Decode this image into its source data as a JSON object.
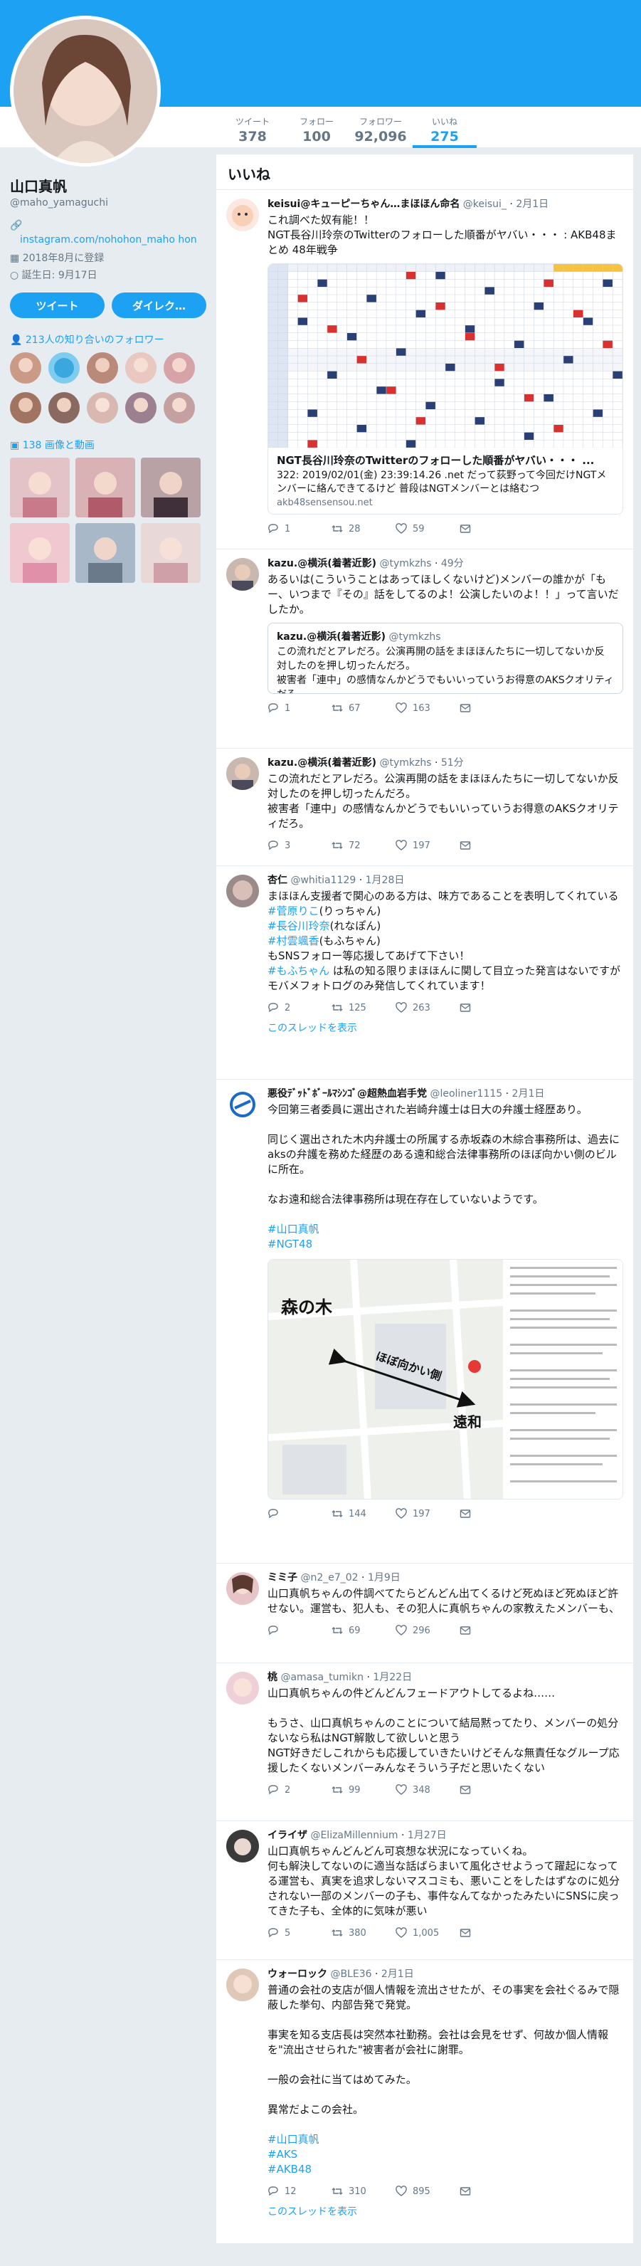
{
  "profile": {
    "name": "山口真帆",
    "handle": "@maho_yamaguchi",
    "link": "instagram.com/nohohon_maho hon",
    "joined": "2018年8月に登録",
    "birthday": "誕生日: 9月17日",
    "tweet_button": "ツイート",
    "dm_button": "ダイレク…",
    "followers_you_know": "213人の知り合いのフォロワー",
    "media_label": "138 画像と動画"
  },
  "stats": [
    {
      "label": "ツイート",
      "value": "378"
    },
    {
      "label": "フォロー",
      "value": "100"
    },
    {
      "label": "フォロワー",
      "value": "92,096"
    },
    {
      "label": "いいね",
      "value": "275"
    }
  ],
  "timeline": {
    "title": "いいね"
  },
  "tweets": [
    {
      "name": "keisui@キューピーちゃん…まほほん命名",
      "handle": "@keisui_",
      "date": "2月1日",
      "text": "これ調べた奴有能！！\nNGT長谷川玲奈のTwitterのフォローした順番がヤバい・・・ : AKB48まとめ 48年戦争",
      "card": {
        "title": "NGT長谷川玲奈のTwitterのフォローした順番がヤバい・・・ ...",
        "desc": "322: 2019/02/01(金) 23:39:14.26 .net だって荻野って今回だけNGTメンバーに絡んできてるけど 普段はNGTメンバーとは絡むつ",
        "url": "akb48sensensou.net"
      },
      "replies": "1",
      "retweets": "28",
      "likes": "59"
    },
    {
      "name": "kazu.@横浜(着著近影)",
      "handle": "@tymkzhs",
      "date": "49分",
      "text": "あるいは(こういうことはあってほしくないけど)メンバーの誰かが「もー、いつまで『その』話をしてるのよ！公演したいのよ！！」って言いだしたか。",
      "quote": {
        "name": "kazu.@横浜(着著近影)",
        "handle": "@tymkzhs",
        "text": "この流れだとアレだろ。公演再開の話をまほほんたちに一切してないか反対したのを押し切ったんだろ。\n被害者「連中」の感情なんかどうでもいいっていうお得意のAKSクオリティだろ。"
      },
      "replies": "1",
      "retweets": "67",
      "likes": "163"
    },
    {
      "name": "kazu.@横浜(着著近影)",
      "handle": "@tymkzhs",
      "date": "51分",
      "text": "この流れだとアレだろ。公演再開の話をまほほんたちに一切してないか反対したのを押し切ったんだろ。\n被害者「連中」の感情なんかどうでもいいっていうお得意のAKSクオリティだろ。",
      "replies": "3",
      "retweets": "72",
      "likes": "197"
    },
    {
      "name": "杏仁",
      "handle": "@whitia1129",
      "date": "1月28日",
      "text": "まほほん支援者で関心のある方は、味方であることを表明してくれている",
      "links": [
        "#菅原りこ",
        "#長谷川玲奈",
        "#村雲颯香",
        "#もふちゃん"
      ],
      "link_suffixes": [
        "(りっちゃん)",
        "(れなぽん)",
        "(もふちゃん)",
        " は私の知る限りまほほんに関して目立った発言はないですがモバメフォトログのみ発信してくれています！"
      ],
      "text_after": "もSNSフォロー等応援してあげて下さい！",
      "show_thread": "このスレッドを表示",
      "replies": "2",
      "retweets": "125",
      "likes": "263"
    },
    {
      "name": "悪役ﾃﾞｯﾄﾞﾎﾞｰﾙﾏｼﾝｺﾞ@超熱血岩手党",
      "handle": "@leoliner1115",
      "date": "2月1日",
      "text": "今回第三者委員に選出された岩崎弁護士は日大の弁護士経歴あり。\n\n同じく選出された木内弁護士の所属する赤坂森の木綜合事務所は、過去にaksの弁護を務めた経歴のある遠和総合法律事務所のほぼ向かい側のビルに所在。\n\nなお遠和総合法律事務所は現在存在していないようです。",
      "tags": [
        "#山口真帆",
        "#NGT48"
      ],
      "map": {
        "label_a": "森の木",
        "label_b": "遠和",
        "label_mid": "ほぼ向かい側"
      },
      "replies": "",
      "retweets": "144",
      "likes": "197"
    },
    {
      "name": "ミミ子",
      "handle": "@n2_e7_02",
      "date": "1月9日",
      "text": "山口真帆ちゃんの件調べてたらどんどん出てくるけど死ぬほど死ぬほど許せない。運営も、犯人も、その犯人に真帆ちゃんの家教えたメンバーも、",
      "replies": "",
      "retweets": "69",
      "likes": "296"
    },
    {
      "name": "桃",
      "handle": "@amasa_tumikn",
      "date": "1月22日",
      "text": "山口真帆ちゃんの件どんどんフェードアウトしてるよね……\n\nもうさ、山口真帆ちゃんのことについて結局黙ってたり、メンバーの処分ないなら私はNGT解散して欲しいと思う\nNGT好きだしこれからも応援していきたいけどそんな無責任なグループ応援したくないメンバーみんなそういう子だと思いたくない",
      "replies": "2",
      "retweets": "99",
      "likes": "348"
    },
    {
      "name": "イライザ",
      "handle": "@ElizaMillennium",
      "date": "1月27日",
      "text": "山口真帆ちゃんどんどん可哀想な状況になっていくね。\n何も解決してないのに適当な話ばらまいて風化させようって躍起になってる運営も、真実を追求しないマスコミも、悪いことをしたはずなのに処分されない一部のメンバーの子も、事件なんてなかったみたいにSNSに戻ってきた子も、全体的に気味が悪い",
      "replies": "5",
      "retweets": "380",
      "likes": "1,005"
    },
    {
      "name": "ウォーロック",
      "handle": "@BLE36",
      "date": "2月1日",
      "text": "普通の会社の支店が個人情報を流出させたが、その事実を会社ぐるみで隠蔽した挙句、内部告発で発覚。\n\n事実を知る支店長は突然本社勤務。会社は会見をせず、何故か個人情報を\"流出させられた\"被害者が会社に謝罪。\n\n一般の会社に当てはめてみた。\n\n異常だよこの会社。",
      "tags": [
        "#山口真帆",
        "#AKS",
        "#AKB48"
      ],
      "show_thread": "このスレッドを表示",
      "replies": "12",
      "retweets": "310",
      "likes": "895"
    }
  ],
  "colors": {
    "accent": "#1da1f2",
    "background": "#e6ecf0"
  }
}
